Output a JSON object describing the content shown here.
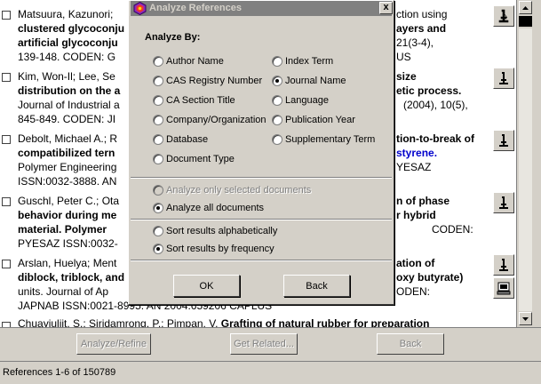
{
  "results": [
    {
      "l1_a": "Matsuura, Kazunori; ",
      "l1_right": "ction using",
      "l2_a": "clustered glycoconju",
      "l2_right": "ayers and",
      "l3_a": "artificial glycoconju",
      "l3_right": "21(3-4),",
      "l4_a": "139-148.  CODEN: G",
      "l4_right": "US"
    },
    {
      "l1_a": "Kim, Won-Il; Lee, Se",
      "l1_right": "size",
      "l2_a": "distribution on the a",
      "l2_right": "etic process.",
      "l3_a": "Journal of Industrial a",
      "l3_right": "(2004),  10(5),",
      "l4_a": "845-849.  CODEN: JI",
      "l4_right": ""
    },
    {
      "l1_a": "Debolt, Michael A.; R",
      "l1_right": "tion-to-break of",
      "l2_a": "compatibilized tern",
      "l2_right": "styrene.",
      "l3_a": "Polymer Engineering",
      "l3_right": "YESAZ",
      "l4_a": "ISSN:0032-3888.  AN",
      "l4_right": ""
    },
    {
      "l1_a": "Guschl, Peter C.; Ota",
      "l1_right": "n of phase",
      "l2_a": "behavior during me",
      "l2_right": "r hybrid",
      "l3_a": "material.  Polymer",
      "l3_right": "CODEN:",
      "l4_a": "PYESAZ  ISSN:0032-",
      "l4_right": ""
    },
    {
      "l1_a": "Arslan, Huelya; Ment",
      "l1_right": "ation of",
      "l2_a": "diblock, triblock, and",
      "l2_right": "oxy butyrate)",
      "l3_a": "units.  Journal of Ap",
      "l3_right": "ODEN:",
      "l4_a": "JAPNAB  ISSN:0021-8995.  AN 2004:659206  CAPLUS",
      "l4_right": ""
    },
    {
      "l1_a": "Chuayjuljit, S.; Siridamrong, P.; Pimpan, V.  ",
      "l1_b": "Grafting of natural rubber for preparation"
    }
  ],
  "toolbar": {
    "analyze_refine": "Analyze/Refine",
    "get_related": "Get Related...",
    "back": "Back"
  },
  "status": "References 1-6 of 150789",
  "dialog": {
    "title": "Analyze References",
    "close": "x",
    "analyze_by": "Analyze By:",
    "left_options": [
      "Author Name",
      "CAS Registry Number",
      "CA Section Title",
      "Company/Organization",
      "Database",
      "Document Type"
    ],
    "right_options": [
      "Index Term",
      "Journal Name",
      "Language",
      "Publication Year",
      "Supplementary Term"
    ],
    "selected_option": "Journal Name",
    "scope": [
      "Analyze only selected documents",
      "Analyze all documents"
    ],
    "sort": [
      "Sort results alphabetically",
      "Sort results by frequency"
    ],
    "ok": "OK",
    "back": "Back"
  }
}
